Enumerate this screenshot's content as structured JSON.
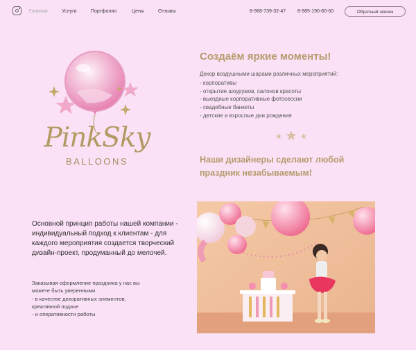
{
  "header": {
    "nav": [
      "Главная",
      "Услуги",
      "Портфолио",
      "Цены",
      "Отзывы"
    ],
    "phones": [
      "8-968-739-32-47",
      "8-985-190-80-60"
    ],
    "callback_label": "Обратный звонок"
  },
  "logo": {
    "brand_line1": "PinkSky",
    "brand_line2": "BALLOONS"
  },
  "hero": {
    "title": "Создаём яркие моменты!",
    "intro": "Декор воздушными шарами различных мероприятий:",
    "list": [
      "- корпоративы",
      "- открытие шоурумов, салонов красоты",
      "- выездные корпоративные фотосессии",
      "- свадебные банкеты",
      "- детские и взрослые дни рождения"
    ],
    "tagline_line1": "Наши дизайнеры сделают любой",
    "tagline_line2": "праздник незабываемым!"
  },
  "about": {
    "principle": "Основной принцип работы нашей компании - индивидуальный подход к клиентам - для каждого мероприятия создается творческий дизайн-проект, продуманный до мелочей.",
    "order_lines": [
      "Заказывая оформление праздника у нас вы",
      "можете быть уверенными",
      "- в качестве декоративных элементов,",
      "креативной подаче",
      "- и оперативности работы"
    ]
  },
  "colors": {
    "background": "#fbe1f6",
    "accent_gold": "#b49c6e",
    "balloon_pink": "#f2a7c9"
  },
  "icons": [
    "instagram-icon",
    "star-icon",
    "sparkle-icon"
  ]
}
